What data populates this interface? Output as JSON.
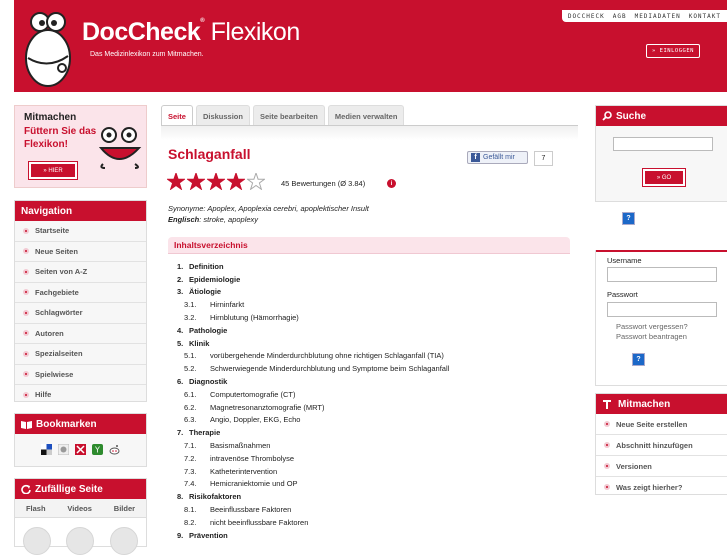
{
  "header": {
    "brand": "DocCheck",
    "product": "Flexikon",
    "tagline": "Das Medizinlexikon zum Mitmachen.",
    "topnav": [
      "DOCCHECK",
      "AGB",
      "MEDIADATEN",
      "KONTAKT"
    ],
    "login_label": "» EINLOGGEN"
  },
  "promo": {
    "line1": "Mitmachen",
    "line2": "Füttern Sie das Flexikon!",
    "button": "» HIER"
  },
  "navigation": {
    "title": "Navigation",
    "items": [
      "Startseite",
      "Neue Seiten",
      "Seiten von A-Z",
      "Fachgebiete",
      "Schlagwörter",
      "Autoren",
      "Spezialseiten",
      "Spielwiese",
      "Hilfe"
    ]
  },
  "bookmarks": {
    "title": "Bookmarken"
  },
  "random": {
    "title": "Zufällige Seite",
    "tabs": [
      "Flash",
      "Videos",
      "Bilder"
    ]
  },
  "tabs": [
    "Seite",
    "Diskussion",
    "Seite bearbeiten",
    "Medien verwalten"
  ],
  "article": {
    "title": "Schlaganfall",
    "like_label": "Gefällt mir",
    "like_count": "7",
    "rating": {
      "stars": 4,
      "max": 5,
      "text": "45 Bewertungen (Ø 3.84)"
    },
    "synonyme_label": "Synonyme:",
    "synonyme": "Apoplex, Apoplexia cerebri, apoplektischer Insult",
    "englisch_label": "Englisch",
    "englisch": ": stroke, apoplexy"
  },
  "toc": {
    "title": "Inhaltsverzeichnis",
    "rows": [
      {
        "level": 1,
        "num": "1.",
        "text": "Definition"
      },
      {
        "level": 1,
        "num": "2.",
        "text": "Epidemiologie"
      },
      {
        "level": 1,
        "num": "3.",
        "text": "Ätiologie"
      },
      {
        "level": 2,
        "num": "3.1.",
        "text": "Hirninfarkt"
      },
      {
        "level": 2,
        "num": "3.2.",
        "text": "Hirnblutung (Hämorrhagie)"
      },
      {
        "level": 1,
        "num": "4.",
        "text": "Pathologie"
      },
      {
        "level": 1,
        "num": "5.",
        "text": "Klinik"
      },
      {
        "level": 2,
        "num": "5.1.",
        "text": "vorübergehende Minderdurchblutung ohne richtigen Schlaganfall (TIA)"
      },
      {
        "level": 2,
        "num": "5.2.",
        "text": "Schwerwiegende Minderdurchblutung und Symptome beim Schlaganfall"
      },
      {
        "level": 1,
        "num": "6.",
        "text": "Diagnostik"
      },
      {
        "level": 2,
        "num": "6.1.",
        "text": "Computertomografie (CT)"
      },
      {
        "level": 2,
        "num": "6.2.",
        "text": "Magnetresonanztomografie (MRT)"
      },
      {
        "level": 2,
        "num": "6.3.",
        "text": "Angio, Doppler, EKG, Echo"
      },
      {
        "level": 1,
        "num": "7.",
        "text": "Therapie"
      },
      {
        "level": 2,
        "num": "7.1.",
        "text": "Basismaßnahmen"
      },
      {
        "level": 2,
        "num": "7.2.",
        "text": "intravenöse Thrombolyse"
      },
      {
        "level": 2,
        "num": "7.3.",
        "text": "Katheterintervention"
      },
      {
        "level": 2,
        "num": "7.4.",
        "text": "Hemicraniektomie und OP"
      },
      {
        "level": 1,
        "num": "8.",
        "text": "Risikofaktoren"
      },
      {
        "level": 2,
        "num": "8.1.",
        "text": "Beeinflussbare Faktoren"
      },
      {
        "level": 2,
        "num": "8.2.",
        "text": "nicht beeinflussbare Faktoren"
      },
      {
        "level": 1,
        "num": "9.",
        "text": "Prävention"
      }
    ]
  },
  "search": {
    "title": "Suche",
    "button": "» GO",
    "help_icon": "?"
  },
  "login": {
    "username_label": "Username",
    "password_label": "Passwort",
    "forgot": "Passwort vergessen?",
    "request": "Passwort beantragen",
    "help_icon": "?"
  },
  "mitmachen": {
    "title": "Mitmachen",
    "items": [
      "Neue Seite erstellen",
      "Abschnitt hinzufügen",
      "Versionen",
      "Was zeigt hierher?"
    ]
  },
  "colors": {
    "brand_red": "#c8102e",
    "link_blue": "#1c68c8",
    "facebook": "#3b5998"
  }
}
